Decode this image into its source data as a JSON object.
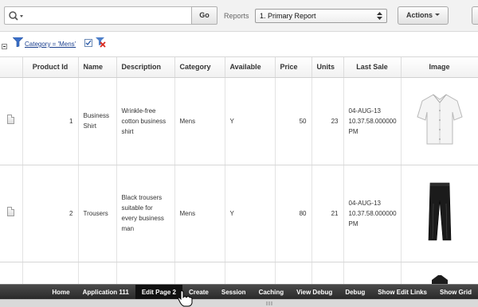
{
  "search": {
    "value": "",
    "placeholder": "",
    "go_label": "Go"
  },
  "reports": {
    "label": "Reports",
    "selected": "1. Primary Report"
  },
  "actions": {
    "label": "Actions"
  },
  "filter": {
    "text": "Category = 'Mens'"
  },
  "table": {
    "headers": [
      "Product Id",
      "Name",
      "Description",
      "Category",
      "Available",
      "Price",
      "Units",
      "Last Sale",
      "Image"
    ],
    "rows": [
      {
        "id": "1",
        "name": "Business Shirt",
        "description": "Wrinkle-free cotton business shirt",
        "category": "Mens",
        "available": "Y",
        "price": "50",
        "units": "23",
        "last_sale": "04-AUG-13 10.37.58.000000 PM",
        "image": "shirt"
      },
      {
        "id": "2",
        "name": "Trousers",
        "description": "Black trousers suitable for every business man",
        "category": "Mens",
        "available": "Y",
        "price": "80",
        "units": "21",
        "last_sale": "04-AUG-13 10.37.58.000000 PM",
        "image": "trousers"
      }
    ]
  },
  "devbar": {
    "items": [
      "Home",
      "Application 111",
      "Edit Page 2",
      "Create",
      "Session",
      "Caching",
      "View Debug",
      "Debug",
      "Show Edit Links",
      "Show Grid"
    ],
    "active": "Edit Page 2"
  },
  "colors": {
    "devbar_bg": "#333333",
    "link": "#1a3f8f",
    "filter_icon": "#3a6fc9"
  }
}
